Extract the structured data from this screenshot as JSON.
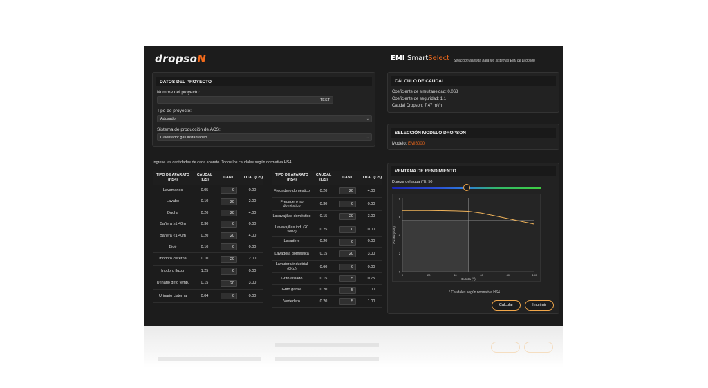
{
  "brand": {
    "logo_main": "dropso",
    "logo_accent": "N"
  },
  "emi": {
    "logo_emi": "EMI",
    "logo_smart": "Smart",
    "logo_select": "Select",
    "tagline": "Selección asistida para los sistemas EMI de Dropson"
  },
  "project": {
    "title": "DATOS DEL PROYECTO",
    "name_label": "Nombre del proyecto:",
    "name_value": "TEST",
    "type_label": "Tipo de proyecto:",
    "type_value": "Adosado",
    "acs_label": "Sistema de producción de ACS:",
    "acs_value": "Calentador gas instantáneo"
  },
  "instructions": "Ingrese las cantidades de cada aparato. Todos los caudales según normativa HS4.",
  "table_headers": {
    "type": "TIPO DE APARATO (HS4)",
    "flow": "CAUDAL (L/S)",
    "qty": "CANT.",
    "total": "TOTAL (L/S)"
  },
  "table_left": [
    {
      "name": "Lavamanos",
      "flow": "0.05",
      "qty": "0",
      "total": "0.00"
    },
    {
      "name": "Lavabo",
      "flow": "0.10",
      "qty": "20",
      "total": "2.00"
    },
    {
      "name": "Ducha",
      "flow": "0.20",
      "qty": "20",
      "total": "4.00"
    },
    {
      "name": "Bañera ≥1.40m",
      "flow": "0.30",
      "qty": "0",
      "total": "0.00"
    },
    {
      "name": "Bañera <1.40m",
      "flow": "0.20",
      "qty": "20",
      "total": "4.00"
    },
    {
      "name": "Bidé",
      "flow": "0.10",
      "qty": "0",
      "total": "0.00"
    },
    {
      "name": "Inodoro cisterna",
      "flow": "0.10",
      "qty": "20",
      "total": "2.00"
    },
    {
      "name": "Inodoro fluxor",
      "flow": "1.25",
      "qty": "0",
      "total": "0.00"
    },
    {
      "name": "Urinario grifo temp.",
      "flow": "0.15",
      "qty": "20",
      "total": "3.00"
    },
    {
      "name": "Urinario cisterna",
      "flow": "0.04",
      "qty": "0",
      "total": "0.00"
    }
  ],
  "table_right": [
    {
      "name": "Fregadero doméstico",
      "flow": "0.20",
      "qty": "20",
      "total": "4.00"
    },
    {
      "name": "Fregadero no doméstico",
      "flow": "0.30",
      "qty": "0",
      "total": "0.00"
    },
    {
      "name": "Lavavajillas doméstico",
      "flow": "0.15",
      "qty": "20",
      "total": "3.00"
    },
    {
      "name": "Lavavajillas ind. (20 serv.)",
      "flow": "0.25",
      "qty": "0",
      "total": "0.00"
    },
    {
      "name": "Lavadero",
      "flow": "0.20",
      "qty": "0",
      "total": "0.00"
    },
    {
      "name": "Lavadora doméstica",
      "flow": "0.15",
      "qty": "20",
      "total": "3.00"
    },
    {
      "name": "Lavadora industrial (8Kg)",
      "flow": "0.60",
      "qty": "0",
      "total": "0.00"
    },
    {
      "name": "Grifo aislado",
      "flow": "0.15",
      "qty": "5",
      "total": "0.75"
    },
    {
      "name": "Grifo garaje",
      "flow": "0.20",
      "qty": "5",
      "total": "1.00"
    },
    {
      "name": "Vertedero",
      "flow": "0.20",
      "qty": "5",
      "total": "1.00"
    }
  ],
  "flow_calc": {
    "title": "CÁLCULO DE CAUDAL",
    "simultaneity": "Coeficiente de simultaneidad: 0.068",
    "safety": "Coeficiente de seguridad: 1.1",
    "flow": "Caudal Dropson: 7.47 m³/h"
  },
  "model": {
    "title": "SELECCIÓN MODELO DROPSON",
    "label": "Modelo:",
    "value": "EMI8000",
    "accent_color": "#f26a1b"
  },
  "performance": {
    "title": "VENTANA DE RENDIMIENTO",
    "hardness_label": "Dureza del agua (°f): 50",
    "hardness_value": 50,
    "note": "* Caudales según normativa HS4",
    "calc_button": "Calcular",
    "print_button": "Imprimir"
  },
  "chart_data": {
    "type": "line",
    "xlabel": "Dureza (°f)",
    "ylabel": "Caudal (m³/h)",
    "xlim": [
      0,
      100
    ],
    "ylim": [
      0,
      8
    ],
    "x_ticks": [
      "0",
      "20",
      "40",
      "60",
      "80",
      "100"
    ],
    "y_ticks": [
      "0",
      "2",
      "4",
      "6",
      "8"
    ],
    "series": [
      {
        "x": [
          0,
          10,
          20,
          30,
          40,
          50,
          60,
          70,
          80,
          90,
          100
        ],
        "y": [
          6.7,
          6.7,
          6.7,
          6.68,
          6.65,
          6.6,
          6.4,
          6.1,
          5.8,
          5.5,
          5.2
        ]
      }
    ],
    "operating_point": {
      "x": 50,
      "y": 5.6
    }
  }
}
